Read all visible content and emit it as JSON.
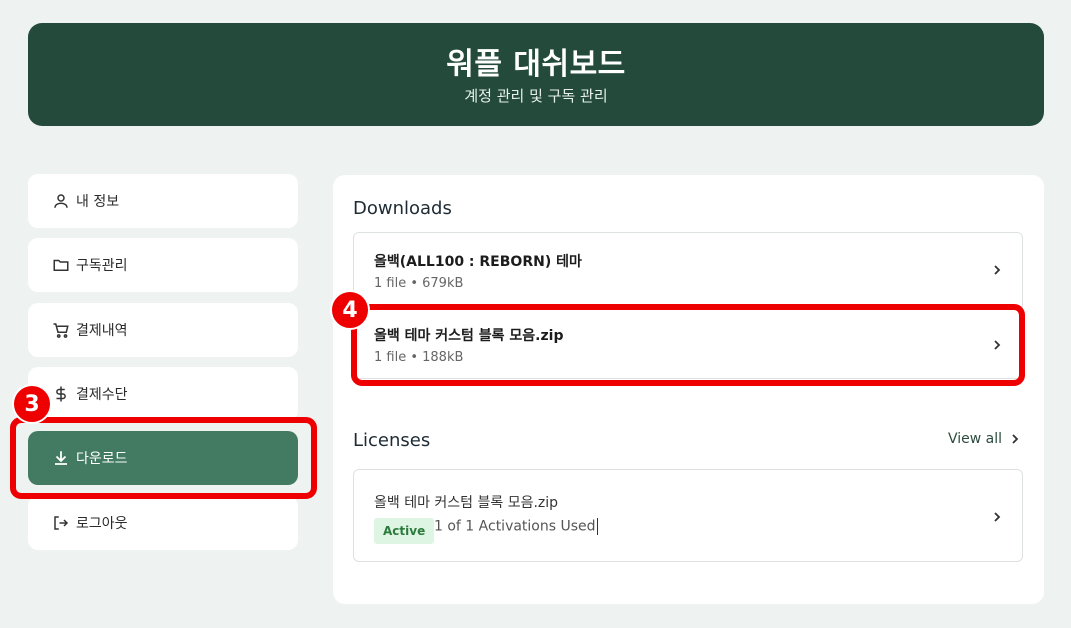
{
  "header": {
    "title": "워플 대쉬보드",
    "subtitle": "계정 관리 및 구독 관리"
  },
  "sidebar": {
    "items": [
      {
        "label": "내 정보",
        "icon": "user-icon",
        "active": false
      },
      {
        "label": "구독관리",
        "icon": "folder-icon",
        "active": false
      },
      {
        "label": "결제내역",
        "icon": "cart-icon",
        "active": false
      },
      {
        "label": "결제수단",
        "icon": "dollar-icon",
        "active": false
      },
      {
        "label": "다운로드",
        "icon": "download-icon",
        "active": true
      },
      {
        "label": "로그아웃",
        "icon": "logout-icon",
        "active": false
      }
    ]
  },
  "downloads": {
    "title": "Downloads",
    "items": [
      {
        "name": "올백(ALL100 : REBORN) 테마",
        "meta": "1 file • 679kB"
      },
      {
        "name": "올백 테마 커스텀 블록 모음.zip",
        "meta": "1 file • 188kB"
      }
    ]
  },
  "licenses": {
    "title": "Licenses",
    "view_all": "View all",
    "items": [
      {
        "name": "올백 테마 커스텀 블록 모음.zip",
        "status": "Active",
        "activations": "1 of 1 Activations Used"
      }
    ]
  },
  "annotations": {
    "step3": "3",
    "step4": "4"
  },
  "colors": {
    "header_bg": "#234a3b",
    "active_nav": "#427a62",
    "highlight": "#e00000",
    "badge_bg": "#dff5e4"
  }
}
